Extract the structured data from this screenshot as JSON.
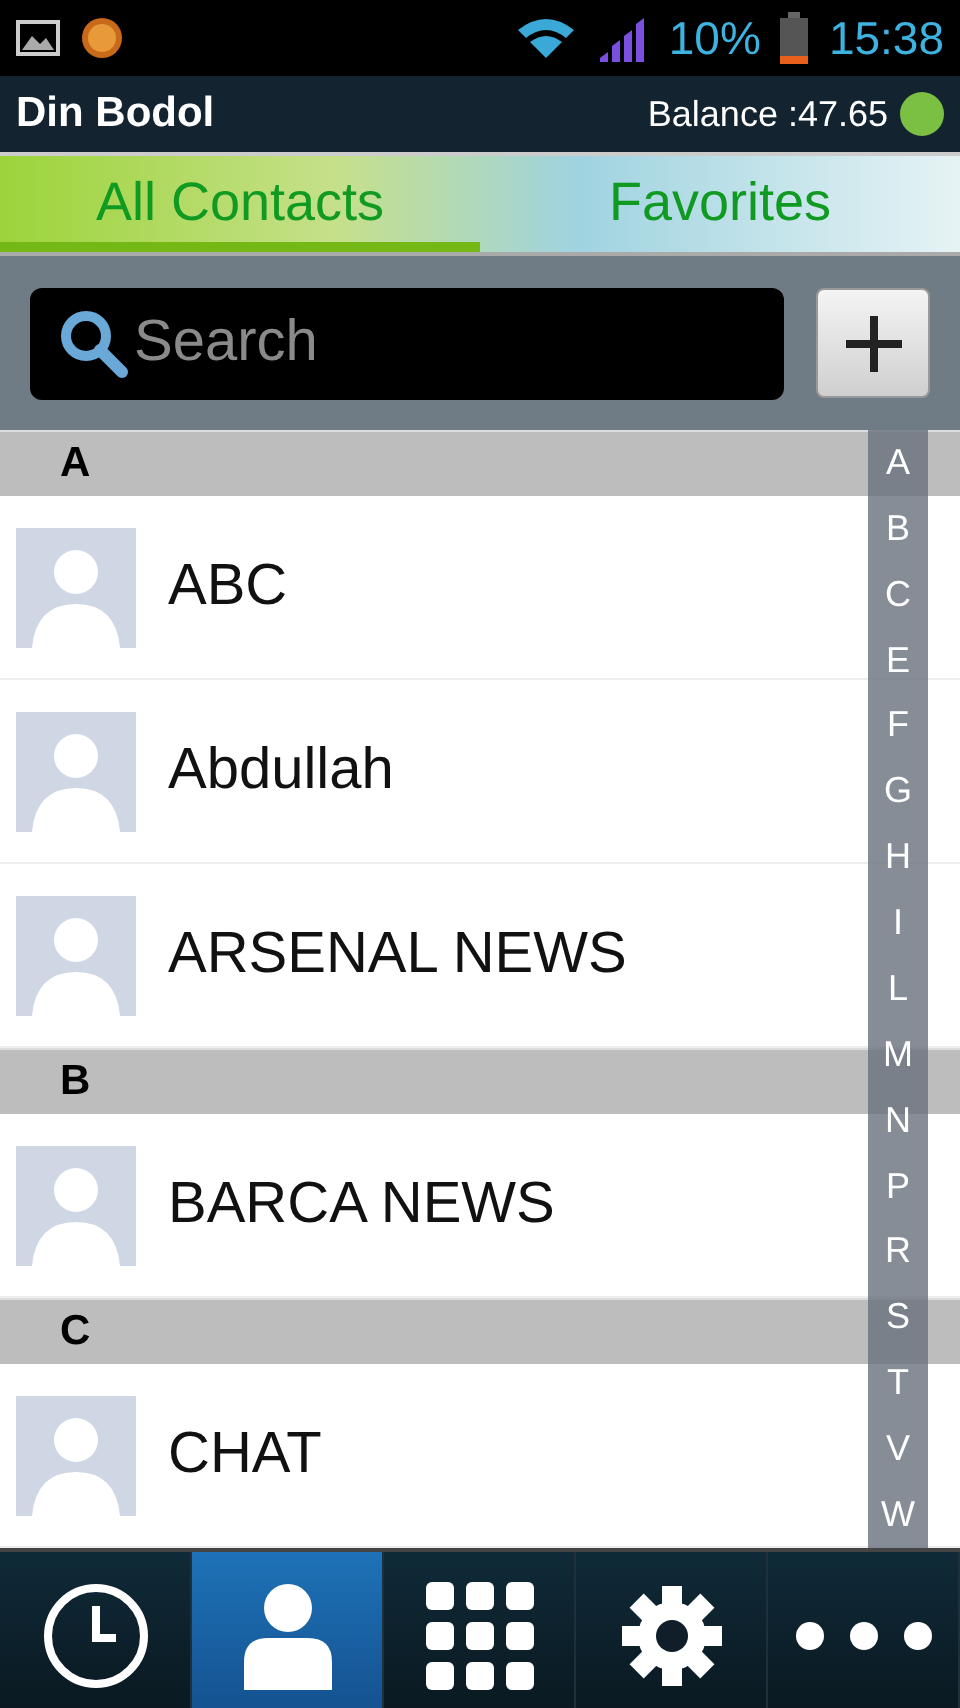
{
  "status_bar": {
    "battery": "10%",
    "time": "15:38"
  },
  "header": {
    "title": "Din Bodol",
    "balance": "Balance :47.65"
  },
  "tabs": [
    {
      "label": "All Contacts",
      "selected": true
    },
    {
      "label": "Favorites",
      "selected": false
    }
  ],
  "search": {
    "placeholder": "Search"
  },
  "sections": [
    {
      "letter": "A",
      "contacts": [
        "ABC",
        "Abdullah",
        "ARSENAL NEWS"
      ]
    },
    {
      "letter": "B",
      "contacts": [
        "BARCA NEWS"
      ]
    },
    {
      "letter": "C",
      "contacts": [
        "CHAT"
      ]
    }
  ],
  "index": [
    "A",
    "B",
    "C",
    "E",
    "F",
    "G",
    "H",
    "I",
    "L",
    "M",
    "N",
    "P",
    "R",
    "S",
    "T",
    "V",
    "W"
  ],
  "nav": [
    {
      "kind": "history",
      "selected": false
    },
    {
      "kind": "contacts",
      "selected": true
    },
    {
      "kind": "dialpad",
      "selected": false
    },
    {
      "kind": "settings",
      "selected": false
    },
    {
      "kind": "more",
      "selected": false
    }
  ]
}
